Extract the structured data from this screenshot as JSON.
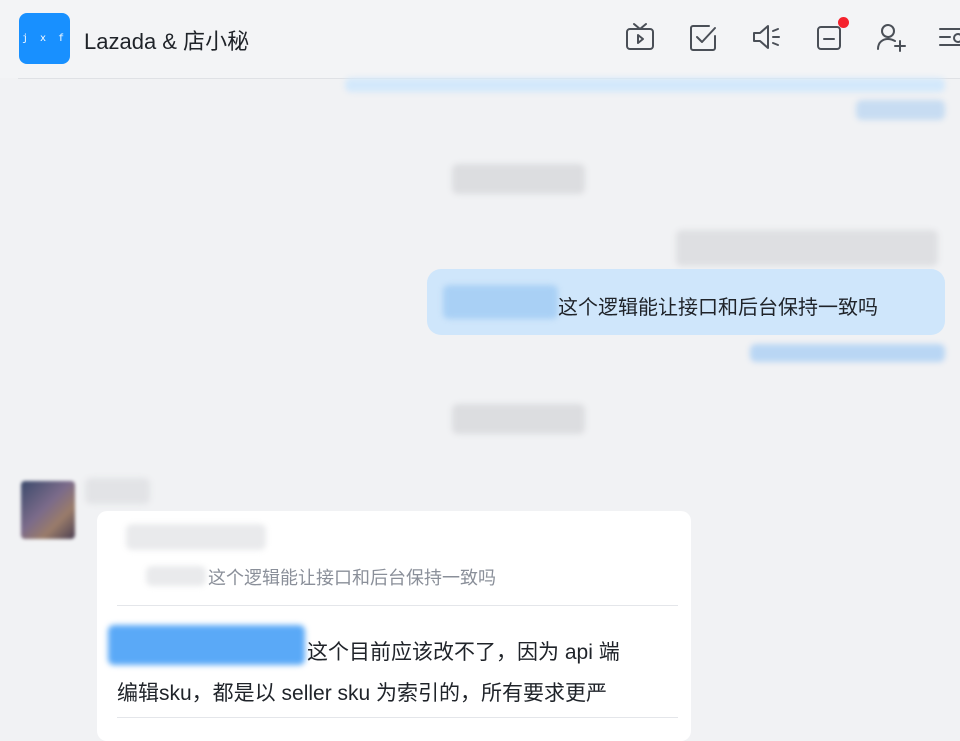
{
  "header": {
    "app_icon_text": "j x f",
    "title": "Lazada & 店小秘",
    "toolbar": {
      "icons": [
        "tv-icon",
        "checkbox-icon",
        "speaker-icon",
        "notice-icon",
        "add-user-icon",
        "menu-icon"
      ],
      "notice_badge_color": "#f5222d"
    }
  },
  "messages": {
    "outgoing": {
      "text": "这个逻辑能让接口和后台保持一致吗"
    },
    "incoming": {
      "quote_text": "这个逻辑能让接口和后台保持一致吗",
      "reply_line1": "这个目前应该改不了，因为 api 端",
      "reply_line2": "编辑sku，都是以 seller sku 为索引的，所有要求更严"
    }
  },
  "colors": {
    "brand": "#1890ff",
    "outgoing_bubble": "#cfe6fb",
    "background": "#f1f2f4"
  }
}
